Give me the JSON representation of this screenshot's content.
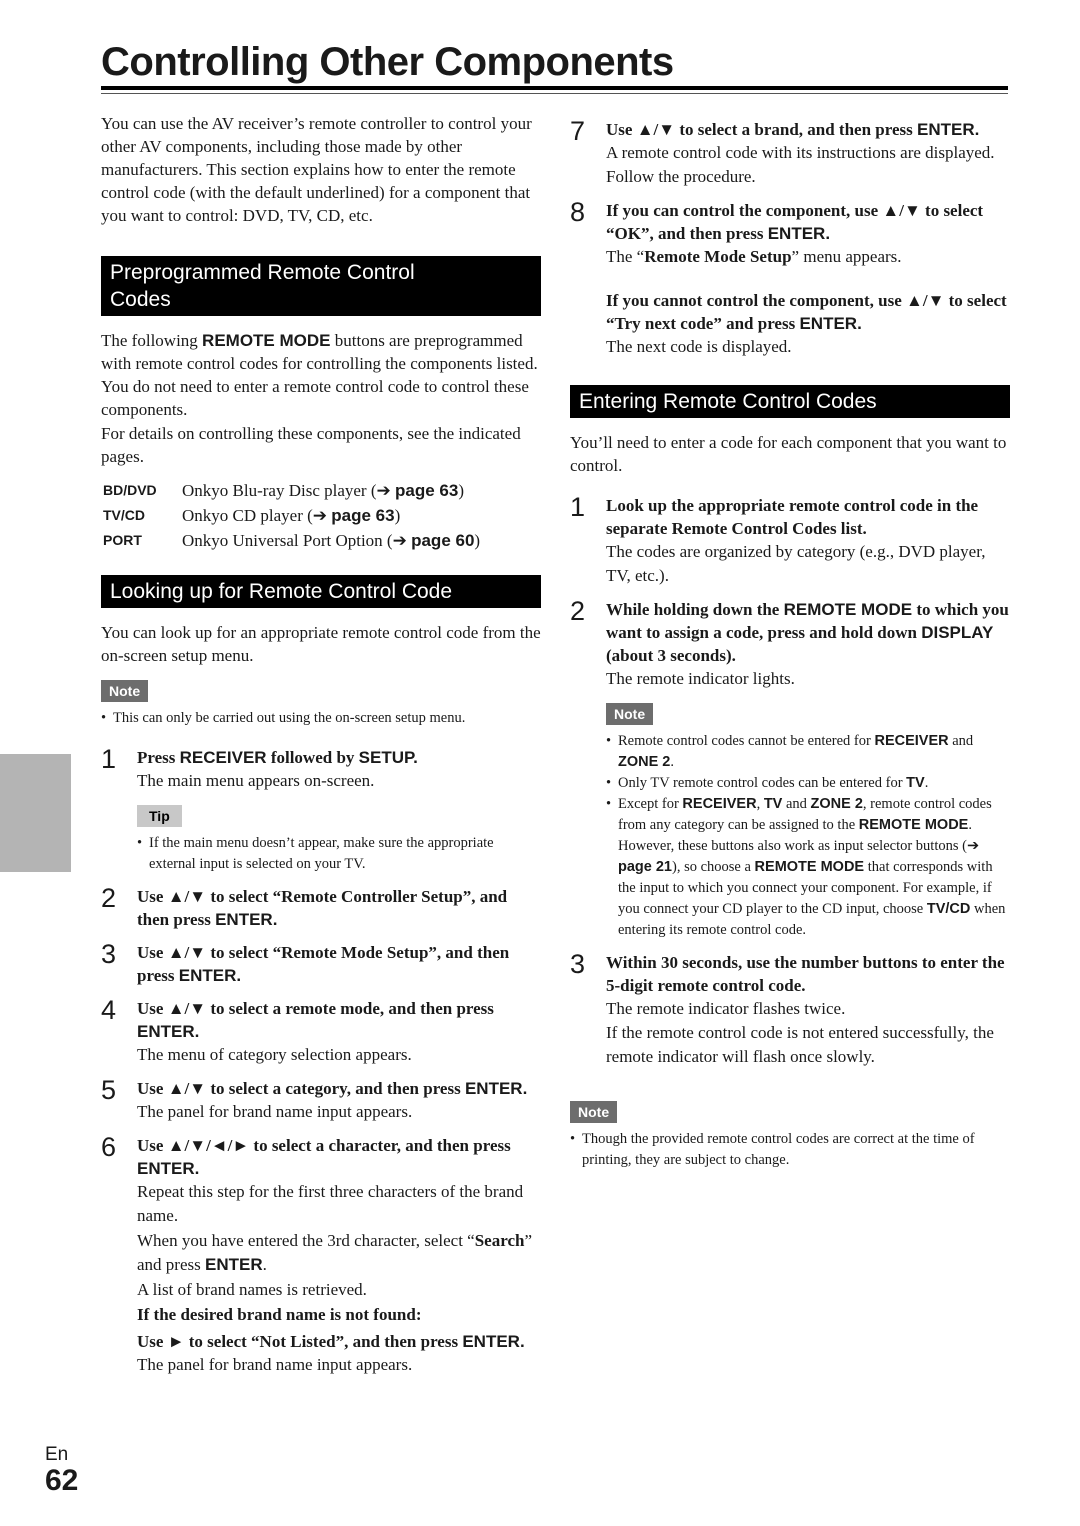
{
  "page": {
    "title": "Controlling Other Components",
    "language": "En",
    "page_number": "62"
  },
  "left": {
    "intro": "You can use the AV receiver’s remote controller to control your other AV components, including those made by other manufacturers. This section explains how to enter the remote control code (with the default underlined) for a component that you want to control: DVD, TV, CD, etc.",
    "preprogrammed": {
      "heading_line1": "Preprogrammed Remote Control",
      "heading_line2": "Codes",
      "p1_a": "The following ",
      "p1_b": "REMOTE MODE",
      "p1_c": " buttons are preprogrammed with remote control codes for controlling the components listed. You do not need to enter a remote control code to control these components.",
      "p2": "For details on controlling these components, see the indicated pages.",
      "modes": [
        {
          "key": "BD/DVD",
          "desc": "Onkyo Blu-ray Disc player (",
          "arrow": "➔",
          "page": "page 63",
          "close": ")"
        },
        {
          "key": "TV/CD",
          "desc": "Onkyo CD player (",
          "arrow": "➔",
          "page": "page 63",
          "close": ")"
        },
        {
          "key": "PORT",
          "desc": "Onkyo Universal Port Option (",
          "arrow": "➔",
          "page": "page 60",
          "close": ")"
        }
      ]
    },
    "lookup": {
      "heading": "Looking up for Remote Control Code",
      "intro": "You can look up for an appropriate remote control code from the on-screen setup menu.",
      "note_label": "Note",
      "note": "This can only be carried out using the on-screen setup menu.",
      "tip_label": "Tip",
      "tip": "If the main menu doesn’t appear, make sure the appropriate external input is selected on your TV.",
      "steps": [
        {
          "num": "1",
          "head_a": "Press ",
          "head_b": "RECEIVER",
          "head_c": " followed by ",
          "head_d": "SETUP.",
          "body": "The main menu appears on-screen."
        },
        {
          "num": "2",
          "head_a": "Use ▲/▼ to select “Remote Controller Setup”, and then press ",
          "head_b": "ENTER."
        },
        {
          "num": "3",
          "head_a": "Use ▲/▼ to select “Remote Mode Setup”, and then press ",
          "head_b": "ENTER."
        },
        {
          "num": "4",
          "head_a": "Use ▲/▼ to select a remote mode, and then press ",
          "head_b": "ENTER.",
          "body": "The menu of category selection appears."
        },
        {
          "num": "5",
          "head_a": "Use ▲/▼ to select a category, and then press ",
          "head_b": "ENTER.",
          "body": "The panel for brand name input appears."
        },
        {
          "num": "6",
          "head_a": "Use ▲/▼/◄/► to select a character, and then press ",
          "head_b": "ENTER.",
          "body1": "Repeat this step for the first three characters of the brand name.",
          "body2_a": "When you have entered the 3rd character, select “",
          "body2_b": "Search",
          "body2_c": "” and press ",
          "body2_d": "ENTER",
          "body2_e": ".",
          "body3": "A list of brand names is retrieved.",
          "notfound_head": "If the desired brand name is not found:",
          "notfound_a": "Use ► to select “Not Listed”, and then press ",
          "notfound_b": "ENTER.",
          "notfound_body": "The panel for brand name input appears."
        }
      ]
    }
  },
  "right": {
    "steps_cont": [
      {
        "num": "7",
        "head_a": "Use ▲/▼ to select a brand, and then press ",
        "head_b": "ENTER.",
        "body": "A remote control code with its instructions are displayed. Follow the procedure."
      },
      {
        "num": "8",
        "head_a": "If you can control the component, use ▲/▼ to select “OK”, and then press ",
        "head_b": "ENTER.",
        "body_a": "The “",
        "body_b": "Remote Mode Setup",
        "body_c": "” menu appears.",
        "alt_head_a": "If you cannot control the component, use ▲/▼ to select “Try next code” and press ",
        "alt_head_b": "ENTER.",
        "alt_body": "The next code is displayed."
      }
    ],
    "entering": {
      "heading": "Entering Remote Control Codes",
      "intro": "You’ll need to enter a code for each component that you want to control.",
      "steps": [
        {
          "num": "1",
          "head": "Look up the appropriate remote control code in the separate Remote Control Codes list.",
          "body": "The codes are organized by category (e.g., DVD player, TV, etc.)."
        },
        {
          "num": "2",
          "head_a": "While holding down the ",
          "head_b": "REMOTE MODE",
          "head_c": " to which you want to assign a code, press and hold down ",
          "head_d": "DISPLAY",
          "head_e": " (about 3 seconds).",
          "body": "The remote indicator lights."
        },
        {
          "num": "3",
          "head": "Within 30 seconds, use the number buttons to enter the 5-digit remote control code.",
          "body1": "The remote indicator flashes twice.",
          "body2": "If the remote control code is not entered successfully, the remote indicator will flash once slowly."
        }
      ],
      "note_label": "Note",
      "notes": [
        {
          "a": "Remote control codes cannot be entered for ",
          "b": "RECEIVER",
          "c": " and ",
          "d": "ZONE 2",
          "e": "."
        },
        {
          "a": "Only TV remote control codes can be entered for ",
          "b": "TV",
          "c": "."
        },
        {
          "a": "Except for ",
          "b": "RECEIVER",
          "c": ", ",
          "d": "TV",
          "e": " and ",
          "f": "ZONE 2",
          "g": ", remote control codes from any category can be assigned to the ",
          "h": "REMOTE MODE",
          "i": ". However, these buttons also work as input selector buttons (",
          "j": "➔",
          "k": " page 21",
          "l": "), so choose a ",
          "m": "REMOTE MODE",
          "n": " that corresponds with the input to which you connect your component. For example, if you connect your CD player to the CD input, choose ",
          "o": "TV/CD",
          "p": " when entering its remote control code."
        }
      ],
      "note2_label": "Note",
      "note2": "Though the provided remote control codes are correct at the time of printing, they are subject to change."
    }
  }
}
